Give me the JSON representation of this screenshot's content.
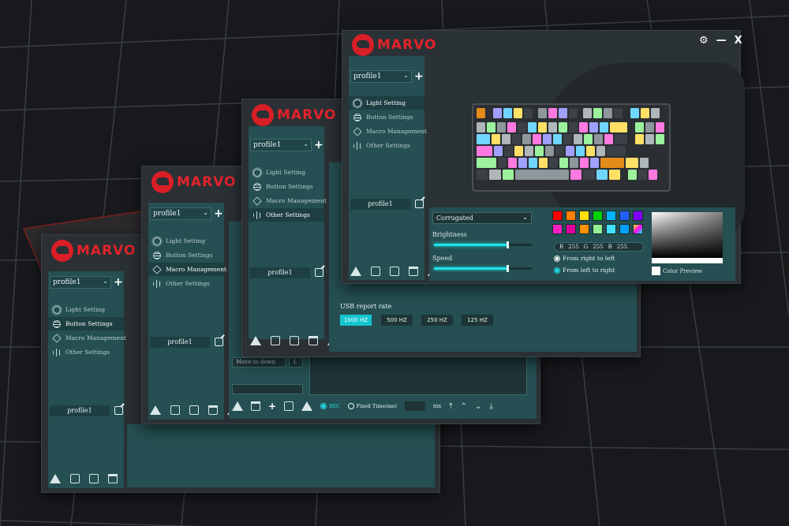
{
  "brand": "MARVO",
  "profile": {
    "selected": "profile1",
    "footer_label": "profile1"
  },
  "menu": {
    "light_setting": "Light Setting",
    "button_settings": "Button Settings",
    "macro_management": "Macro Management",
    "other_settings": "Other Settings"
  },
  "light": {
    "mode": "Corrugated",
    "brightness_label": "Brightness",
    "brightness": 0.75,
    "speed_label": "Speed",
    "speed": 0.75,
    "rgb": {
      "r_label": "R",
      "r": "255",
      "g_label": "G",
      "g": "255",
      "b_label": "B",
      "b": "255"
    },
    "direction_right_to_left": "From right to left",
    "direction_left_to_right": "From left to right",
    "color_preview_label": "Color Preview",
    "swatches": [
      "#ff0000",
      "#ff7f00",
      "#ffe000",
      "#00d000",
      "#00b4ff",
      "#2060ff",
      "#8000ff",
      "#ff20c0",
      "#e000a0",
      "#ff9000",
      "#90f090",
      "#40e0ff",
      "#00a0ff"
    ]
  },
  "other": {
    "usb_report_rate_label": "USB report rate",
    "rates": [
      "1000 HZ",
      "500 HZ",
      "250 HZ",
      "125 HZ"
    ]
  },
  "macro": {
    "move_to_down": "Move to down",
    "move_value": "1",
    "rec_label": "REC",
    "fixed_time_label": "Fixed Time(ms)",
    "ms_label": "ms"
  },
  "icons": {
    "settings": "gear-icon",
    "minimize": "minimize-icon",
    "close": "close-icon"
  },
  "window_controls": {
    "settings": "⚙",
    "minimize": "—",
    "close": "X"
  }
}
